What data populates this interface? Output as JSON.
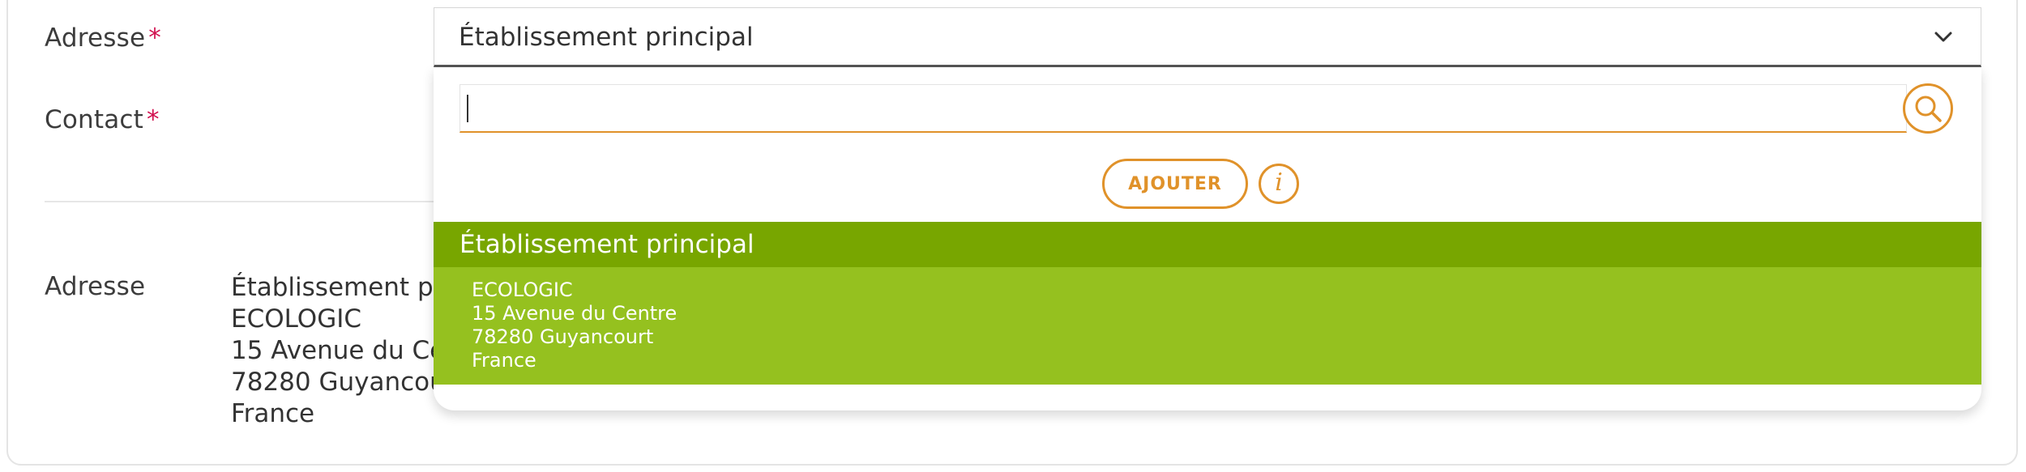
{
  "form": {
    "adresse_label": "Adresse",
    "contact_label": "Contact",
    "required_mark": "*"
  },
  "select": {
    "value": "Établissement principal"
  },
  "dropdown": {
    "search_value": "",
    "add_button": "AJOUTER",
    "info_glyph": "i",
    "group_label": "Établissement principal",
    "options": [
      {
        "line1": "ECOLOGIC",
        "line2": "15 Avenue du Centre",
        "line3": "78280 Guyancourt",
        "line4": "France"
      }
    ]
  },
  "summary": {
    "label": "Adresse",
    "lines": [
      "Établissement principal",
      "ECOLOGIC",
      "15 Avenue du Centre",
      "78280 Guyancourt",
      "France"
    ]
  },
  "colors": {
    "accent_orange": "#e0922a",
    "group_green": "#78a600",
    "option_green": "#95c11f",
    "required_red": "#d1114f"
  },
  "icons": [
    "chevron-down-icon",
    "search-icon",
    "info-icon"
  ]
}
